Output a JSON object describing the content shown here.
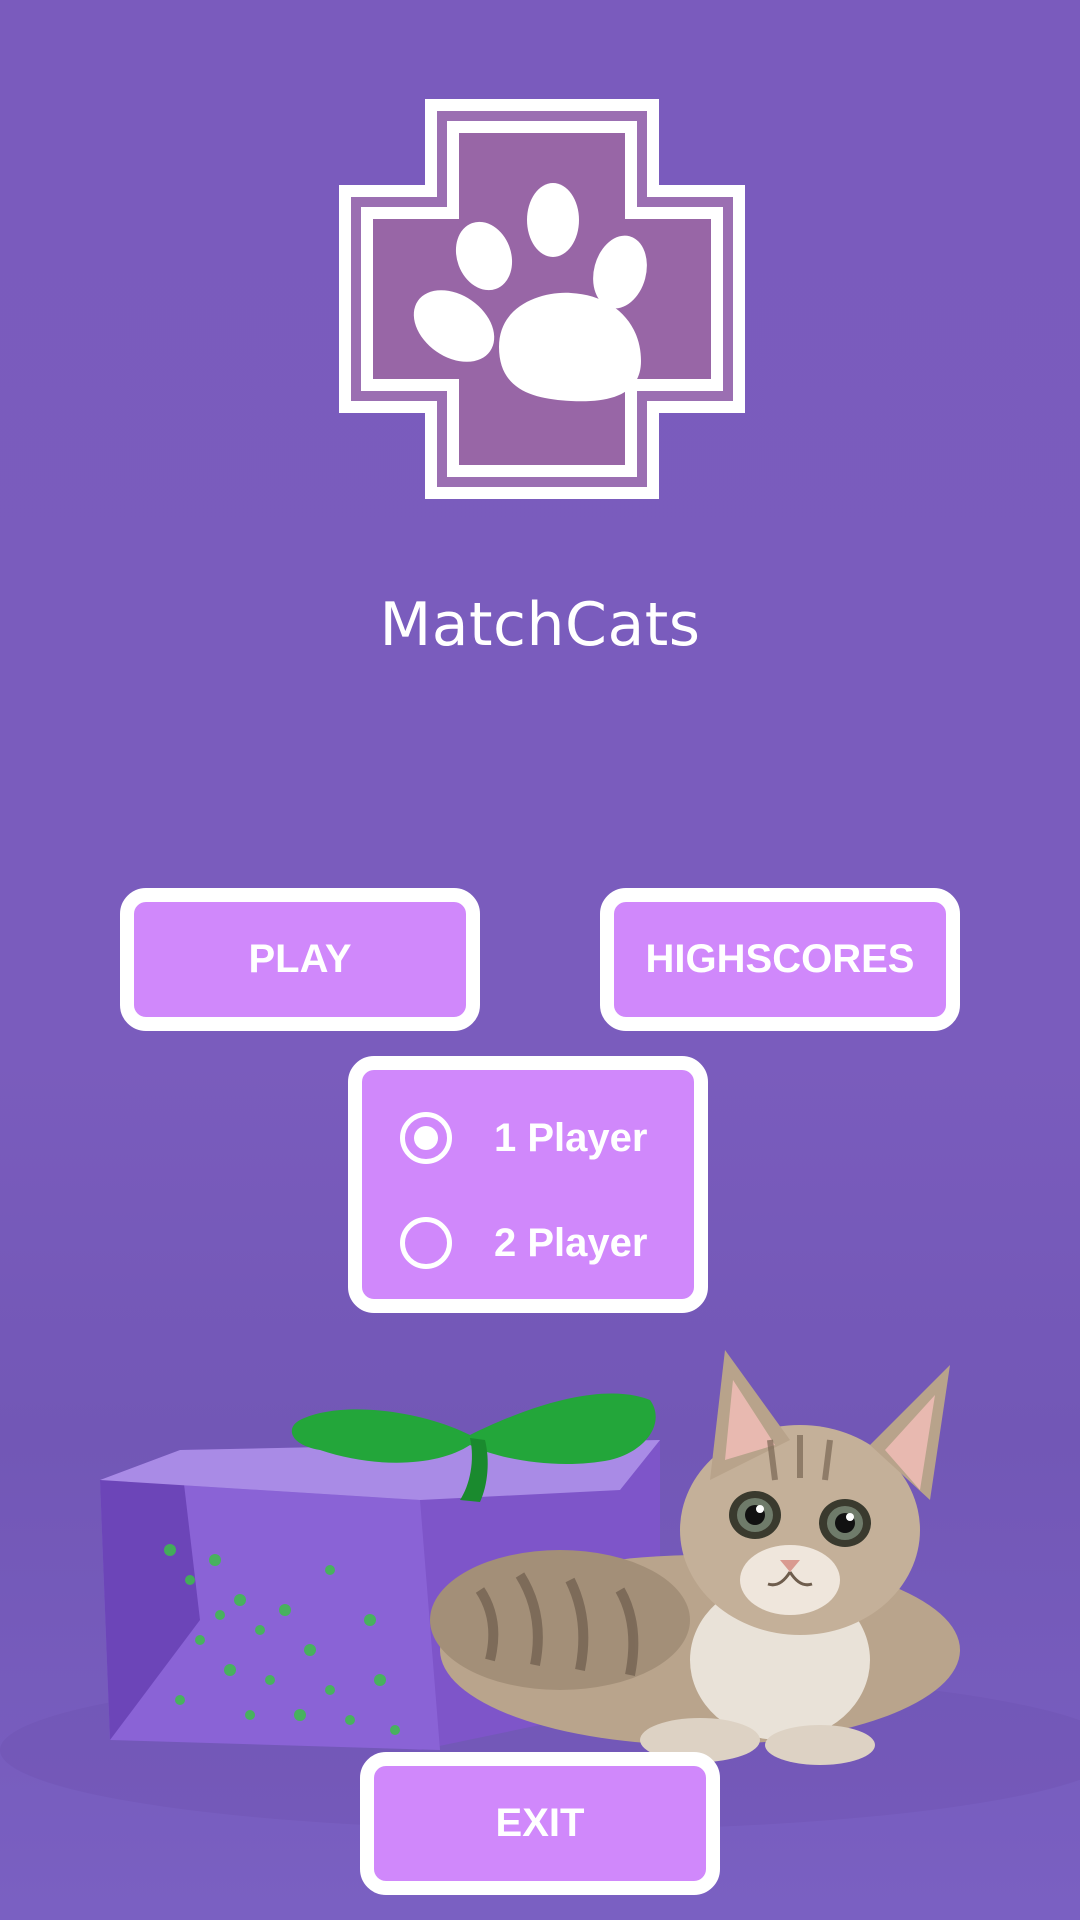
{
  "app": {
    "title": "MatchCats"
  },
  "logo": {
    "icon": "paw-cross-icon",
    "colors": {
      "frame": "#ffffff",
      "fill": "#9866a6",
      "paw": "#ffffff"
    }
  },
  "menu": {
    "play_label": "PLAY",
    "highscores_label": "HIGHSCORES",
    "exit_label": "EXIT"
  },
  "player_mode": {
    "options": [
      {
        "label": "1 Player",
        "selected": true
      },
      {
        "label": "2 Player",
        "selected": false
      }
    ]
  },
  "theme": {
    "background": "#7b5cbc",
    "button_fill": "#d088fb",
    "button_border": "#ffffff"
  },
  "scene": {
    "description_icon": "kitten-in-gift-bag-illustration"
  }
}
